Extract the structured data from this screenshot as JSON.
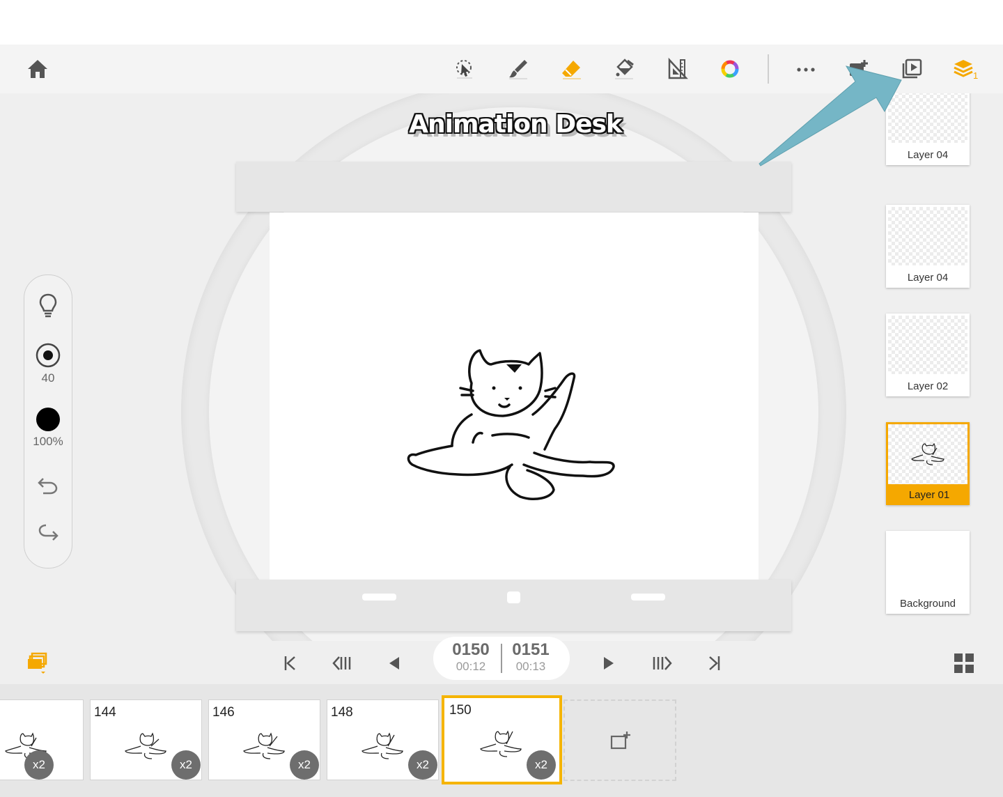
{
  "app": {
    "logo_text": "Animation Desk"
  },
  "toolbar": {
    "home": "home-icon",
    "tools": [
      "lasso-select-icon",
      "brush-icon",
      "eraser-icon",
      "fill-bucket-icon",
      "ruler-icon",
      "color-wheel-icon"
    ],
    "more": "more-icon",
    "right": [
      "add-frame-icon",
      "play-preview-icon",
      "layers-icon"
    ],
    "layers_badge": "1",
    "accent_color": "#f5a800"
  },
  "left_panel": {
    "brush_size": "40",
    "opacity": "100%",
    "items": [
      "lightbulb-icon",
      "brush-size-icon",
      "color-swatch-icon",
      "undo-icon",
      "redo-icon"
    ]
  },
  "layers": [
    {
      "name": "Layer 04"
    },
    {
      "name": "Layer 04"
    },
    {
      "name": "Layer 02"
    },
    {
      "name": "Layer 01",
      "active": true
    },
    {
      "name": "Background"
    }
  ],
  "playback": {
    "current_frame": "0150",
    "current_time": "00:12",
    "next_frame": "0151",
    "next_time": "00:13"
  },
  "frames": [
    {
      "number": "",
      "hold": "x2"
    },
    {
      "number": "144",
      "hold": "x2"
    },
    {
      "number": "146",
      "hold": "x2"
    },
    {
      "number": "148",
      "hold": "x2"
    },
    {
      "number": "150",
      "hold": "x2",
      "selected": true
    }
  ]
}
